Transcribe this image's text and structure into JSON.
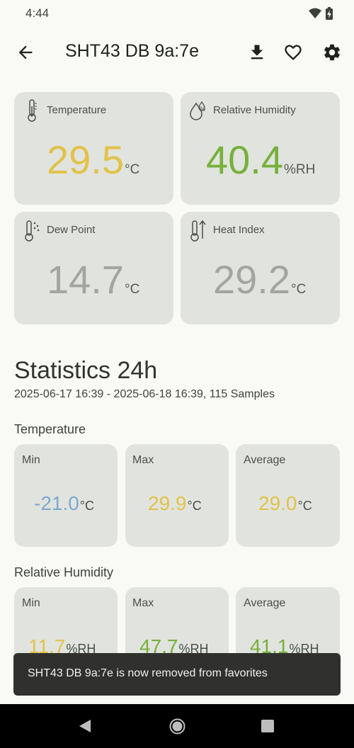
{
  "status": {
    "time": "4:44"
  },
  "appbar": {
    "title": "SHT43 DB 9a:7e"
  },
  "cards": {
    "temperature": {
      "label": "Temperature",
      "value": "29.5",
      "unit": "°C",
      "color": "#e2c24a"
    },
    "humidity": {
      "label": "Relative Humidity",
      "value": "40.4",
      "unit": "%RH",
      "color": "#76b13b"
    },
    "dewpoint": {
      "label": "Dew Point",
      "value": "14.7",
      "unit": "°C",
      "color": "#a3a5a1"
    },
    "heatindex": {
      "label": "Heat Index",
      "value": "29.2",
      "unit": "°C",
      "color": "#a3a5a1"
    }
  },
  "stats": {
    "title": "Statistics 24h",
    "range": "2025-06-17 16:39 - 2025-06-18 16:39, 115 Samples",
    "temperature": {
      "heading": "Temperature",
      "min": {
        "label": "Min",
        "value": "-21.0",
        "unit": "°C",
        "color": "#7da9cf"
      },
      "max": {
        "label": "Max",
        "value": "29.9",
        "unit": "°C",
        "color": "#e2c24a"
      },
      "avg": {
        "label": "Average",
        "value": "29.0",
        "unit": "°C",
        "color": "#e2c24a"
      }
    },
    "humidity": {
      "heading": "Relative Humidity",
      "min": {
        "label": "Min",
        "value": "11.7",
        "unit": "%RH",
        "color": "#e2c24a"
      },
      "max": {
        "label": "Max",
        "value": "47.7",
        "unit": "%RH",
        "color": "#76b13b"
      },
      "avg": {
        "label": "Average",
        "value": "41.1",
        "unit": "%RH",
        "color": "#76b13b"
      }
    }
  },
  "snackbar": {
    "message": "SHT43 DB 9a:7e is now removed from favorites"
  }
}
